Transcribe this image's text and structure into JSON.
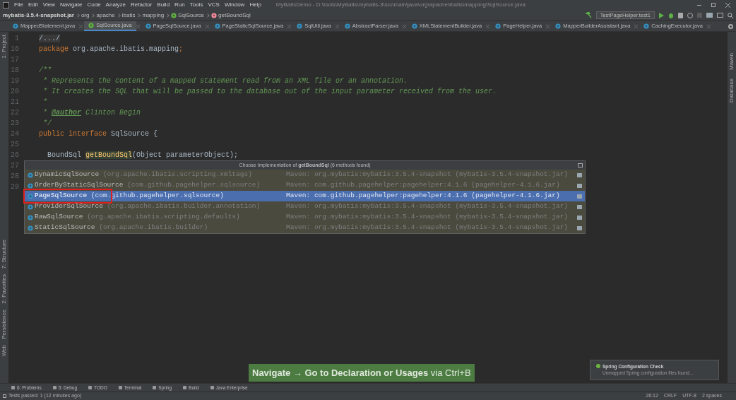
{
  "menu": [
    "File",
    "Edit",
    "View",
    "Navigate",
    "Code",
    "Analyze",
    "Refactor",
    "Build",
    "Run",
    "Tools",
    "VCS",
    "Window",
    "Help"
  ],
  "window": {
    "title": "MyBatisDemo - D:\\tools\\MyBatis\\mybatis-3\\src\\main\\java\\org\\apache\\ibatis\\mapping\\SqlSource.java"
  },
  "breadcrumbs": [
    {
      "label": "mybatis-3.5.4-snapshot.jar",
      "kind": "jar"
    },
    {
      "label": "org",
      "kind": "package"
    },
    {
      "label": "apache",
      "kind": "package"
    },
    {
      "label": "ibatis",
      "kind": "package"
    },
    {
      "label": "mapping",
      "kind": "package"
    },
    {
      "label": "SqlSource",
      "kind": "interface"
    },
    {
      "label": "getBoundSql",
      "kind": "method"
    }
  ],
  "run_config": "TestPageHelper.test1",
  "tabs": [
    {
      "label": "MappedStatement.java",
      "kind": "class",
      "selected": false
    },
    {
      "label": "SqlSource.java",
      "kind": "interface",
      "selected": true
    },
    {
      "label": "PageSqlSource.java",
      "kind": "class",
      "selected": false
    },
    {
      "label": "PageStaticSqlSource.java",
      "kind": "class",
      "selected": false
    },
    {
      "label": "SqlUtil.java",
      "kind": "class",
      "selected": false
    },
    {
      "label": "AbstractParser.java",
      "kind": "class",
      "selected": false
    },
    {
      "label": "XMLStatementBuilder.java",
      "kind": "class",
      "selected": false
    },
    {
      "label": "PageHelper.java",
      "kind": "class",
      "selected": false
    },
    {
      "label": "MapperBuilderAssistant.java",
      "kind": "class",
      "selected": false
    },
    {
      "label": "CachingExecutor.java",
      "kind": "class",
      "selected": false
    }
  ],
  "left_tool_windows": [
    "1: Project",
    "7: Structure",
    "2: Favorites",
    "Persistence",
    "Web"
  ],
  "right_tool_windows": [
    "Maven",
    "Database"
  ],
  "code_lines": [
    {
      "number": "1",
      "tokens": [
        {
          "text": "/.../",
          "kind": "folded"
        }
      ]
    },
    {
      "number": "16",
      "tokens": [
        {
          "text": "package ",
          "kind": "keyword"
        },
        {
          "text": "org.apache.ibatis.mapping",
          "kind": "plain"
        },
        {
          "text": ";",
          "kind": "keyword"
        }
      ]
    },
    {
      "number": "17"
    },
    {
      "number": "18",
      "tokens": [
        {
          "text": "/**",
          "kind": "comment"
        }
      ]
    },
    {
      "number": "19",
      "tokens": [
        {
          "text": " * Represents the content of a mapped statement read from an XML file or an annotation.",
          "kind": "comment"
        }
      ]
    },
    {
      "number": "20",
      "tokens": [
        {
          "text": " * It creates the SQL that will be passed to the database out of the input parameter received from the user.",
          "kind": "comment"
        }
      ]
    },
    {
      "number": "21",
      "tokens": [
        {
          "text": " *",
          "kind": "comment"
        }
      ]
    },
    {
      "number": "22",
      "tokens": [
        {
          "text": " * ",
          "kind": "comment"
        },
        {
          "text": "@author",
          "kind": "doctag"
        },
        {
          "text": " Clinton Begin",
          "kind": "comment"
        }
      ]
    },
    {
      "number": "23",
      "tokens": [
        {
          "text": " */",
          "kind": "comment"
        }
      ]
    },
    {
      "number": "24",
      "tokens": [
        {
          "text": "public interface ",
          "kind": "keyword"
        },
        {
          "text": "SqlSource {",
          "kind": "plain"
        }
      ]
    },
    {
      "number": "25"
    },
    {
      "number": "26",
      "tokens": [
        {
          "text": "  BoundSql ",
          "kind": "plain"
        },
        {
          "text": "getBoundSql",
          "kind": "method"
        },
        {
          "text": "(Object parameterObject);",
          "kind": "plain"
        }
      ]
    },
    {
      "number": "27"
    },
    {
      "number": "28"
    },
    {
      "number": "29"
    }
  ],
  "popup": {
    "title": "Choose Implementation of **getBoundSql** (6 methods found)",
    "rows": [
      {
        "name": "DynamicSqlSource",
        "package": "(org.apache.ibatis.scripting.xmltags)",
        "location": "Maven: org.mybatis:mybatis:3.5.4-snapshot (mybatis-3.5.4-snapshot.jar)",
        "selected": false,
        "marked": false
      },
      {
        "name": "OrderByStaticSqlSource",
        "package": "(com.github.pagehelper.sqlsource)",
        "location": "Maven: com.github.pagehelper:pagehelper:4.1.6 (pagehelper-4.1.6.jar)",
        "selected": false,
        "marked": false
      },
      {
        "name": "PageSqlSource",
        "package": "(com.github.pagehelper.sqlsource)",
        "location": "Maven: com.github.pagehelper:pagehelper:4.1.6 (pagehelper-4.1.6.jar)",
        "selected": true,
        "marked": true
      },
      {
        "name": "ProviderSqlSource",
        "package": "(org.apache.ibatis.builder.annotation)",
        "location": "Maven: org.mybatis:mybatis:3.5.4-snapshot (mybatis-3.5.4-snapshot.jar)",
        "selected": false,
        "marked": false
      },
      {
        "name": "RawSqlSource",
        "package": "(org.apache.ibatis.scripting.defaults)",
        "location": "Maven: org.mybatis:mybatis:3.5.4-snapshot (mybatis-3.5.4-snapshot.jar)",
        "selected": false,
        "marked": false
      },
      {
        "name": "StaticSqlSource",
        "package": "(org.apache.ibatis.builder)",
        "location": "Maven: org.mybatis:mybatis:3.5.4-snapshot (mybatis-3.5.4-snapshot.jar)",
        "selected": false,
        "marked": false
      }
    ]
  },
  "notification": {
    "title": "Spring Configuration Check",
    "body": "Unmapped Spring configuration files found..."
  },
  "tip": "**Navigate → Go to Declaration or Usages** via Ctrl+B",
  "bottom_tabs": [
    "6: Problems",
    "5: Debug",
    "TODO",
    "Terminal",
    "Spring",
    "Build",
    "Java Enterprise"
  ],
  "status_bar": {
    "message": "Tests passed: 1 (12 minutes ago)",
    "items": [
      "26:12",
      "CRLF",
      "UTF-8",
      "2 spaces"
    ]
  }
}
